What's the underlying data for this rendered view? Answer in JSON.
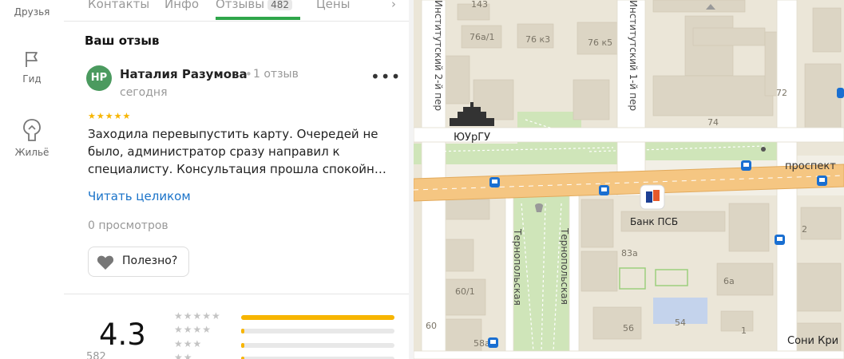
{
  "sidebar": {
    "items": [
      {
        "label": "Друзья",
        "icon": "friends-icon"
      },
      {
        "label": "Гид",
        "icon": "flag-icon"
      },
      {
        "label": "Жильё",
        "icon": "house-icon"
      }
    ]
  },
  "tabs": [
    {
      "label": "Контакты"
    },
    {
      "label": "Инфо"
    },
    {
      "label": "Отзывы",
      "badge": "482",
      "active": true
    },
    {
      "label": "Цены"
    }
  ],
  "review_section": {
    "title": "Ваш отзыв",
    "review": {
      "avatar_initials": "НР",
      "author": "Наталия Разумова",
      "reviews_count": "1 отзыв",
      "date": "сегодня",
      "rating": 5,
      "stars": "★★★★★",
      "text": "Заходила перевыпустить карту. Очередей не было, администратор сразу направил к специалисту. Консультация прошла спокойн…",
      "read_more": "Читать целиком",
      "views": "0 просмотров",
      "useful_label": "Полезно?"
    }
  },
  "rating_summary": {
    "value": "4.3",
    "sub_label": "582",
    "distribution": [
      {
        "stars": "★★★★★",
        "fraction": 1.0
      },
      {
        "stars": "★★★★",
        "fraction": 0.02
      },
      {
        "stars": "★★★",
        "fraction": 0.02
      },
      {
        "stars": "★★",
        "fraction": 0.02
      }
    ]
  },
  "map": {
    "streets": {
      "inst2": "Институтский 2-й пер",
      "inst1": "Институтский 1-й пер",
      "prospekt": "проспект ",
      "ternop_a": "Тернопольская",
      "ternop_b": "Тернопольская"
    },
    "pois": {
      "univ": "ЮУрГУ",
      "bank": "Банк ПСБ",
      "soni": "Сони Кри"
    },
    "houses": [
      "143",
      "76а/1",
      "76 к3",
      "76 к5",
      "72",
      "74",
      "83а",
      "6а",
      "56",
      "54",
      "60/1",
      "60",
      "58а/1",
      "1",
      "2"
    ],
    "colors": {
      "background": "#f2efe6",
      "block": "#ebe6d8",
      "building": "#dcd5c4",
      "park": "#cfe5b9",
      "road": "#ffffff",
      "avenue": "#f5c682",
      "transit": "#1a6fd1"
    }
  }
}
